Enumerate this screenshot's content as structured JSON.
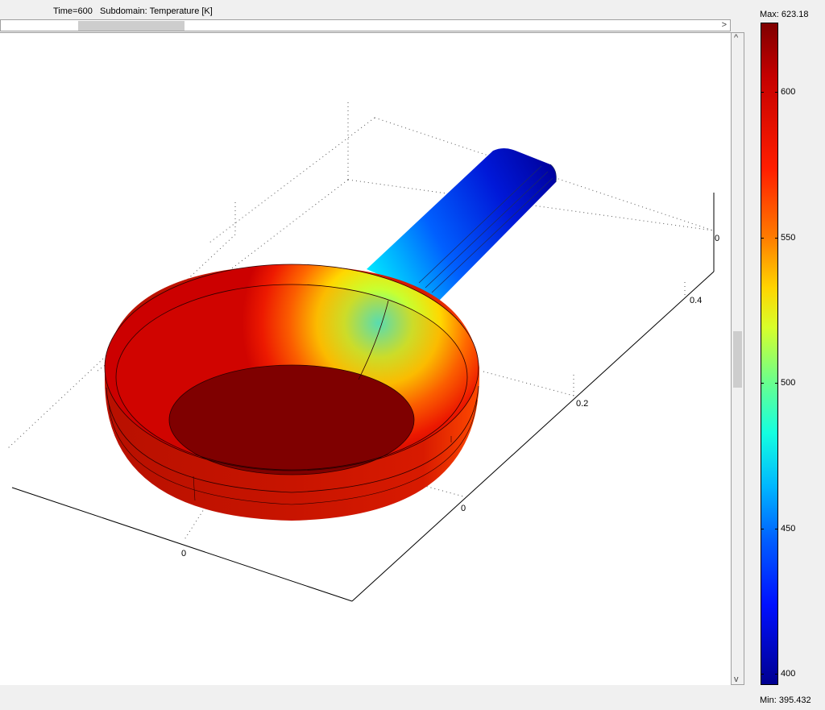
{
  "header": {
    "time_label": "Time=600",
    "subdomain_label": "Subdomain: Temperature [K]"
  },
  "legend": {
    "max_label": "Max: 623.18",
    "min_label": "Min: 395.432",
    "ticks": [
      "600",
      "550",
      "500",
      "450",
      "400"
    ]
  },
  "axes": {
    "x_ticks": [
      "0"
    ],
    "y_ticks": [
      "0",
      "0.2",
      "0.4"
    ],
    "z_ticks": [
      "0"
    ]
  },
  "scrollbars": {
    "right_arrow": ">",
    "up_arrow": "^",
    "down_arrow": "v"
  },
  "colors": {
    "hot": "#7f0000",
    "cold": "#000090"
  }
}
